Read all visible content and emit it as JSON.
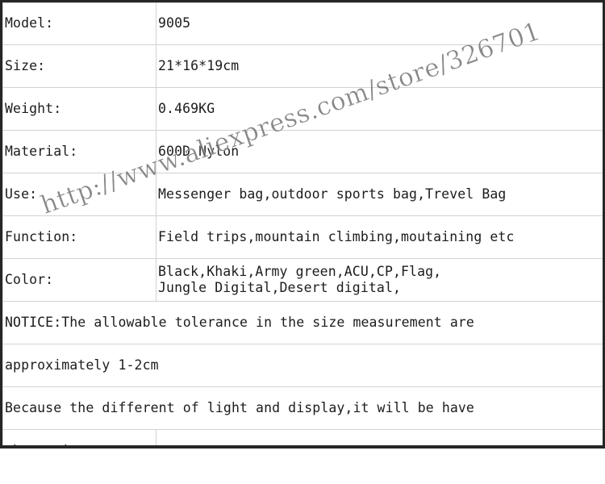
{
  "page": {
    "background_color": "#ffffff",
    "table_border_color": "#262626",
    "cell_border_color": "#d2d2d2",
    "text_color": "#1c1c1c"
  },
  "watermark": {
    "text": "http://www.aliexpress.com/store/326701",
    "color": "#6d6d6d",
    "angle_deg": -19.5
  },
  "spec_table": {
    "rows": [
      {
        "label": "Model:",
        "value": "9005"
      },
      {
        "label": "Size:",
        "value": "21*16*19cm"
      },
      {
        "label": "Weight:",
        "value": "0.469KG"
      },
      {
        "label": "Material:",
        "value": "600D Nylon"
      },
      {
        "label": "Use:",
        "value": "Messenger bag,outdoor sports bag,Trevel Bag"
      },
      {
        "label": "Function:",
        "value": "Field trips,mountain climbing,moutaining etc"
      },
      {
        "label": "Color:",
        "value": "Black,Khaki,Army green,ACU,CP,Flag,\nJungle Digital,Desert digital,"
      }
    ],
    "notice_rows": [
      "NOTICE:The allowable tolerance in the size measurement are",
      "approximately 1-2cm",
      "Because the different of light and display,it will be have"
    ],
    "final_row": {
      "label": "aberration",
      "value": ""
    }
  }
}
